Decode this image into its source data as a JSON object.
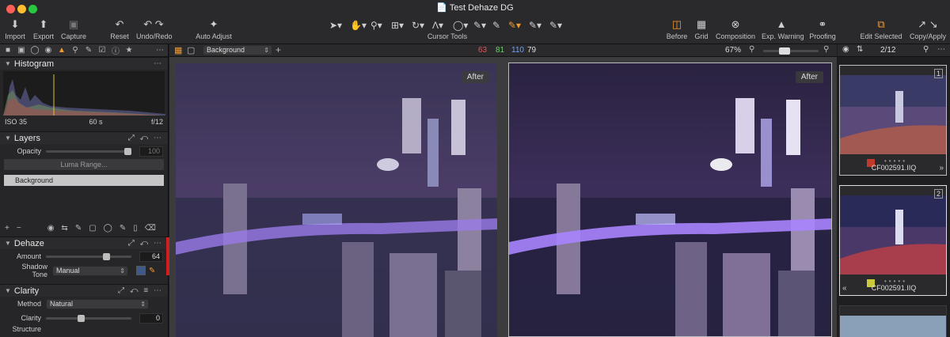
{
  "window": {
    "title": "Test Dehaze DG"
  },
  "colors": {
    "accent_orange": "#f29a2e",
    "red_marker": "#d11e1e",
    "swatch_blue": "#3f5a8a",
    "swatch_yellow": "#c9c93a",
    "swatch_red": "#c0392b"
  },
  "toolbar": {
    "left_tools": [
      {
        "label": "Import",
        "icon": "import-icon"
      },
      {
        "label": "Export",
        "icon": "export-icon"
      },
      {
        "label": "Capture",
        "icon": "camera-icon"
      },
      {
        "label": "Reset",
        "icon": "reset-icon"
      },
      {
        "label": "Undo/Redo",
        "icon": "undo-redo-icon"
      },
      {
        "label": "Auto Adjust",
        "icon": "magic-wand-icon"
      }
    ],
    "cursor_tools_label": "Cursor Tools",
    "right_tools": [
      {
        "label": "Before",
        "icon": "before-icon"
      },
      {
        "label": "Grid",
        "icon": "grid-icon"
      },
      {
        "label": "Composition",
        "icon": "composition-icon"
      },
      {
        "label": "Exp. Warning",
        "icon": "warning-icon"
      },
      {
        "label": "Proofing",
        "icon": "glasses-icon"
      },
      {
        "label": "Edit Selected",
        "icon": "edit-selected-icon"
      },
      {
        "label": "Copy/Apply",
        "icon": "copy-apply-icon"
      }
    ]
  },
  "viewer_bar": {
    "layer_select": "Background",
    "rgb": {
      "r": "63",
      "g": "81",
      "b": "110",
      "l": "79"
    },
    "zoom": "67%"
  },
  "browser_bar": {
    "count": "2/12"
  },
  "histogram": {
    "title": "Histogram",
    "iso": "ISO 35",
    "shutter": "60 s",
    "aperture": "f/12"
  },
  "layers": {
    "title": "Layers",
    "opacity_label": "Opacity",
    "opacity_value": "100",
    "luma_button": "Luma Range...",
    "layer_name": "Background"
  },
  "dehaze": {
    "title": "Dehaze",
    "amount_label": "Amount",
    "amount_value": "64",
    "shadow_label": "Shadow Tone",
    "shadow_value": "Manual"
  },
  "clarity": {
    "title": "Clarity",
    "method_label": "Method",
    "method_value": "Natural",
    "clarity_label": "Clarity",
    "clarity_value": "0",
    "structure_label": "Structure"
  },
  "viewer": {
    "left_tag": "After",
    "right_tag": "After"
  },
  "thumbnails": [
    {
      "num": "1",
      "file": "CF002591.IIQ"
    },
    {
      "num": "2",
      "file": "CF002591.IIQ"
    }
  ]
}
